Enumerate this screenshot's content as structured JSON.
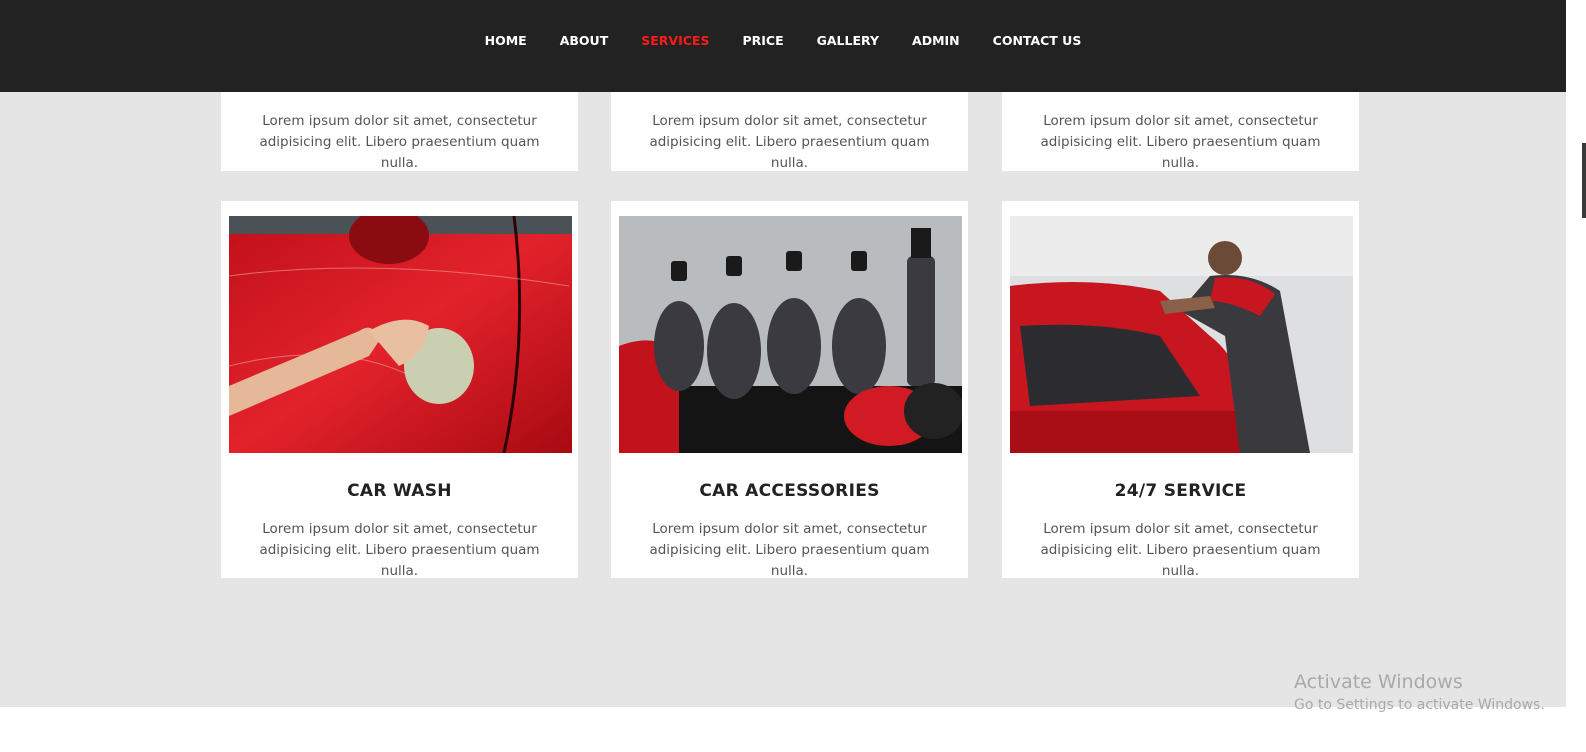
{
  "nav": {
    "items": [
      {
        "label": "HOME",
        "active": false
      },
      {
        "label": "ABOUT",
        "active": false
      },
      {
        "label": "SERVICES",
        "active": true
      },
      {
        "label": "PRICE",
        "active": false
      },
      {
        "label": "GALLERY",
        "active": false
      },
      {
        "label": "ADMIN",
        "active": false
      },
      {
        "label": "CONTACT US",
        "active": false
      }
    ],
    "active_color": "#ff1a1a",
    "bg_color": "#222222"
  },
  "top_cards": [
    {
      "text": "Lorem ipsum dolor sit amet, consectetur adipisicing elit. Libero praesentium quam nulla."
    },
    {
      "text": "Lorem ipsum dolor sit amet, consectetur adipisicing elit. Libero praesentium quam nulla."
    },
    {
      "text": "Lorem ipsum dolor sit amet, consectetur adipisicing elit. Libero praesentium quam nulla."
    }
  ],
  "services": [
    {
      "title": "CAR WASH",
      "text": "Lorem ipsum dolor sit amet, consectetur adipisicing elit. Libero praesentium quam nulla.",
      "image": "car-wash-photo"
    },
    {
      "title": "CAR ACCESSORIES",
      "text": "Lorem ipsum dolor sit amet, consectetur adipisicing elit. Libero praesentium quam nulla.",
      "image": "car-accessories-photo"
    },
    {
      "title": "24/7 SERVICE",
      "text": "Lorem ipsum dolor sit amet, consectetur adipisicing elit. Libero praesentium quam nulla.",
      "image": "mechanic-service-photo"
    }
  ],
  "watermark": {
    "title": "Activate Windows",
    "subtitle": "Go to Settings to activate Windows."
  }
}
